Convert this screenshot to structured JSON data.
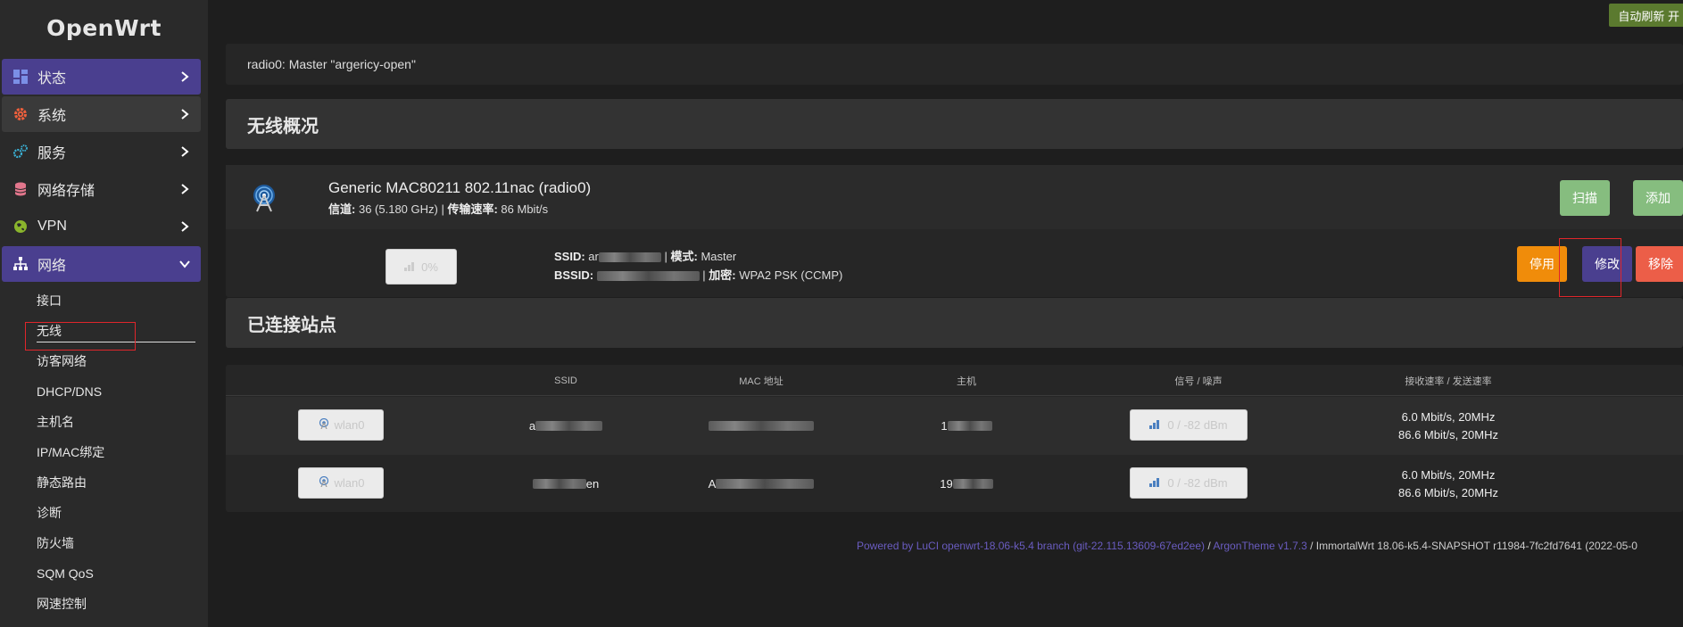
{
  "app": {
    "logo": "OpenWrt"
  },
  "header": {
    "autorefresh_label": "自动刷新 开"
  },
  "nav": {
    "items": [
      {
        "label": "状态",
        "icon": "dashboard-icon"
      },
      {
        "label": "系统",
        "icon": "gear-icon"
      },
      {
        "label": "服务",
        "icon": "gears-icon"
      },
      {
        "label": "网络存储",
        "icon": "database-icon"
      },
      {
        "label": "VPN",
        "icon": "vpn-globe-icon"
      },
      {
        "label": "网络",
        "icon": "sitemap-icon"
      }
    ],
    "subitems": [
      "接口",
      "无线",
      "访客网络",
      "DHCP/DNS",
      "主机名",
      "IP/MAC绑定",
      "静态路由",
      "诊断",
      "防火墙",
      "SQM QoS",
      "网速控制"
    ],
    "active_subitem": "无线"
  },
  "notice": {
    "text": "radio0: Master \"argericy-open\""
  },
  "overview": {
    "title": "无线概况",
    "radio": {
      "name": "Generic MAC80211 802.11nac (radio0)",
      "channel_label": "信道:",
      "channel_value": "36 (5.180 GHz)",
      "rate_label": "传输速率:",
      "rate_value": "86 Mbit/s",
      "scan_button": "扫描",
      "add_button": "添加"
    },
    "network": {
      "signal": "0%",
      "ssid_label": "SSID:",
      "ssid_value": "ar",
      "mode_label": "模式:",
      "mode_value": "Master",
      "bssid_label": "BSSID:",
      "enc_label": "加密:",
      "enc_value": "WPA2 PSK (CCMP)",
      "disable_button": "停用",
      "edit_button": "修改",
      "remove_button": "移除"
    }
  },
  "stations": {
    "title": "已连接站点",
    "columns": [
      "SSID",
      "MAC 地址",
      "主机",
      "信号 / 噪声",
      "接收速率 / 发送速率"
    ],
    "rows": [
      {
        "iface": "wlan0",
        "ssid": "a",
        "mac": "",
        "host": "1",
        "signal": "0 / -82 dBm",
        "rx": "6.0 Mbit/s, 20MHz",
        "tx": "86.6 Mbit/s, 20MHz"
      },
      {
        "iface": "wlan0",
        "ssid": "en",
        "mac": "A",
        "host": "19",
        "signal": "0 / -82 dBm",
        "rx": "6.0 Mbit/s, 20MHz",
        "tx": "86.6 Mbit/s, 20MHz"
      }
    ]
  },
  "footer": {
    "luci": "Powered by LuCI openwrt-18.06-k5.4 branch (git-22.115.13609-67ed2ee)",
    "sep1": " / ",
    "theme": "ArgonTheme v1.7.3",
    "sep2": " / ",
    "build": "ImmortalWrt 18.06-k5.4-SNAPSHOT r11984-7fc2fd7641 (2022-05-0"
  },
  "colors": {
    "accent": "#4a3f8f",
    "green": "#86bd7f",
    "orange": "#f08c0a",
    "red": "#ec5e48"
  }
}
